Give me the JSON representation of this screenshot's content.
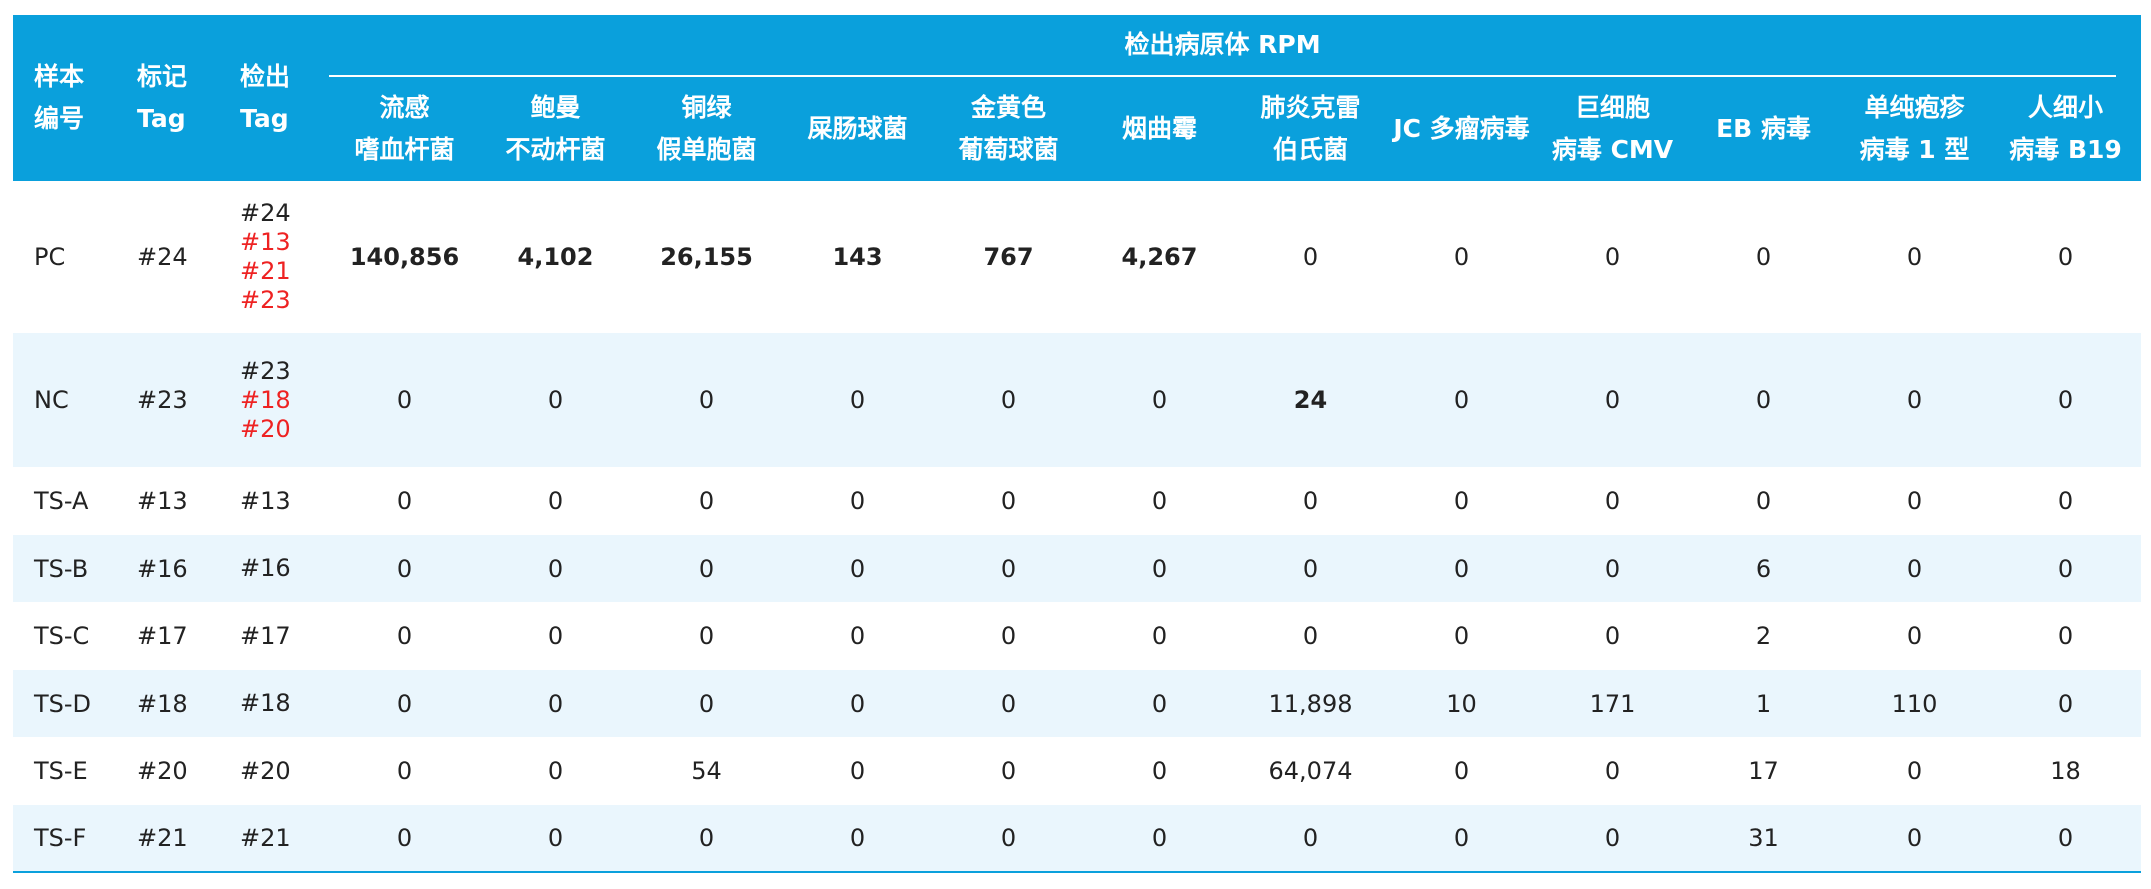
{
  "header": {
    "sample_id": [
      "样本",
      "编号"
    ],
    "mark_tag": [
      "标记",
      "Tag"
    ],
    "detect_tag": [
      "检出",
      "Tag"
    ],
    "group_title": "检出病原体 RPM",
    "pathogens": [
      [
        "流感",
        "嗜血杆菌"
      ],
      [
        "鲍曼",
        "不动杆菌"
      ],
      [
        "铜绿",
        "假单胞菌"
      ],
      [
        "屎肠球菌"
      ],
      [
        "金黄色",
        "葡萄球菌"
      ],
      [
        "烟曲霉"
      ],
      [
        "肺炎克雷",
        "伯氏菌"
      ],
      [
        "JC 多瘤病毒"
      ],
      [
        "巨细胞",
        "病毒 CMV"
      ],
      [
        "EB 病毒"
      ],
      [
        "单纯疱疹",
        "病毒 1 型"
      ],
      [
        "人细小",
        "病毒 B19"
      ]
    ]
  },
  "rows": [
    {
      "sample": "PC",
      "mark": "#24",
      "detected": [
        {
          "t": "#24",
          "s": "black"
        },
        {
          "t": "#13",
          "s": "red"
        },
        {
          "t": "#21",
          "s": "red"
        },
        {
          "t": "#23",
          "s": "red"
        }
      ],
      "values": [
        "140,856",
        "4,102",
        "26,155",
        "143",
        "767",
        "4,267",
        "0",
        "0",
        "0",
        "0",
        "0",
        "0"
      ],
      "styles": [
        "strong",
        "strong",
        "strong",
        "strong",
        "strong",
        "strong",
        "",
        "",
        "",
        "",
        "",
        ""
      ],
      "height": 152
    },
    {
      "sample": "NC",
      "mark": "#23",
      "detected": [
        {
          "t": "#23",
          "s": "black"
        },
        {
          "t": "#18",
          "s": "red"
        },
        {
          "t": "#20",
          "s": "red"
        }
      ],
      "values": [
        "0",
        "0",
        "0",
        "0",
        "0",
        "0",
        "24",
        "0",
        "0",
        "0",
        "0",
        "0"
      ],
      "styles": [
        "",
        "",
        "",
        "",
        "",
        "",
        "alert",
        "",
        "",
        "",
        "",
        ""
      ],
      "height": 134
    },
    {
      "sample": "TS-A",
      "mark": "#13",
      "detected": [
        {
          "t": "#13",
          "s": "black"
        }
      ],
      "values": [
        "0",
        "0",
        "0",
        "0",
        "0",
        "0",
        "0",
        "0",
        "0",
        "0",
        "0",
        "0"
      ],
      "styles": [
        "",
        "",
        "",
        "",
        "",
        "",
        "",
        "",
        "",
        "",
        "",
        ""
      ],
      "height": 68
    },
    {
      "sample": "TS-B",
      "mark": "#16",
      "detected": [
        {
          "t": "#16",
          "s": "black"
        }
      ],
      "values": [
        "0",
        "0",
        "0",
        "0",
        "0",
        "0",
        "0",
        "0",
        "0",
        "6",
        "0",
        "0"
      ],
      "styles": [
        "",
        "",
        "",
        "",
        "",
        "",
        "",
        "",
        "",
        "soft",
        "",
        ""
      ],
      "height": 67
    },
    {
      "sample": "TS-C",
      "mark": "#17",
      "detected": [
        {
          "t": "#17",
          "s": "black"
        }
      ],
      "values": [
        "0",
        "0",
        "0",
        "0",
        "0",
        "0",
        "0",
        "0",
        "0",
        "2",
        "0",
        "0"
      ],
      "styles": [
        "",
        "",
        "",
        "",
        "",
        "",
        "",
        "",
        "",
        "soft",
        "",
        ""
      ],
      "height": 68
    },
    {
      "sample": "TS-D",
      "mark": "#18",
      "detected": [
        {
          "t": "#18",
          "s": "black"
        }
      ],
      "values": [
        "0",
        "0",
        "0",
        "0",
        "0",
        "0",
        "11,898",
        "10",
        "171",
        "1",
        "110",
        "0"
      ],
      "styles": [
        "",
        "",
        "",
        "",
        "",
        "",
        "soft",
        "soft",
        "soft",
        "soft",
        "soft",
        ""
      ],
      "height": 67
    },
    {
      "sample": "TS-E",
      "mark": "#20",
      "detected": [
        {
          "t": "#20",
          "s": "black"
        }
      ],
      "values": [
        "0",
        "0",
        "54",
        "0",
        "0",
        "0",
        "64,074",
        "0",
        "0",
        "17",
        "0",
        "18"
      ],
      "styles": [
        "",
        "",
        "soft",
        "",
        "",
        "",
        "soft",
        "",
        "",
        "soft",
        "",
        "soft"
      ],
      "height": 68
    },
    {
      "sample": "TS-F",
      "mark": "#21",
      "detected": [
        {
          "t": "#21",
          "s": "black"
        }
      ],
      "values": [
        "0",
        "0",
        "0",
        "0",
        "0",
        "0",
        "0",
        "0",
        "0",
        "31",
        "0",
        "0"
      ],
      "styles": [
        "",
        "",
        "",
        "",
        "",
        "",
        "",
        "",
        "",
        "soft",
        "",
        ""
      ],
      "height": 67
    }
  ],
  "colors": {
    "header_bg": "#0aa0dc",
    "row_alt_bg": "#eaf6fd",
    "strong_green": "#1aa84a",
    "soft_green": "#7cce62",
    "alert_red": "#ee1111"
  }
}
